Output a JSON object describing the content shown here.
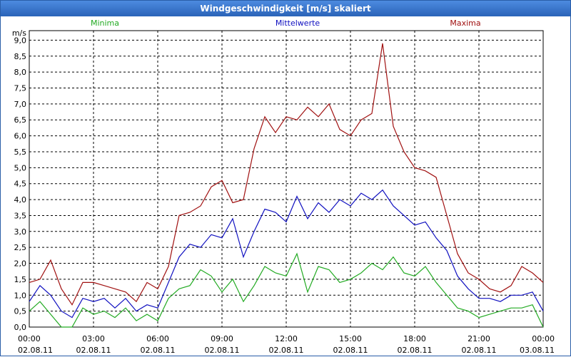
{
  "window": {
    "title": "Windgeschwindigkeit [m/s] skaliert"
  },
  "chart_data": {
    "type": "line",
    "title": "Windgeschwindigkeit [m/s] skaliert",
    "ylabel": "m/s",
    "xlabel": "",
    "ylim": [
      0,
      9.3
    ],
    "xlim": [
      0,
      24
    ],
    "grid": true,
    "legend_position": "top",
    "y_ticks": [
      "0,0",
      "0,5",
      "1,0",
      "1,5",
      "2,0",
      "2,5",
      "3,0",
      "3,5",
      "4,0",
      "4,5",
      "5,0",
      "5,5",
      "6,0",
      "6,5",
      "7,0",
      "7,5",
      "8,0",
      "8,5",
      "9,0"
    ],
    "x_ticks": [
      {
        "time": "00:00",
        "date": "02.08.11"
      },
      {
        "time": "03:00",
        "date": "02.08.11"
      },
      {
        "time": "06:00",
        "date": "02.08.11"
      },
      {
        "time": "09:00",
        "date": "02.08.11"
      },
      {
        "time": "12:00",
        "date": "02.08.11"
      },
      {
        "time": "15:00",
        "date": "02.08.11"
      },
      {
        "time": "18:00",
        "date": "02.08.11"
      },
      {
        "time": "21:00",
        "date": "02.08.11"
      },
      {
        "time": "00:00",
        "date": "03.08.11"
      }
    ],
    "x": [
      0,
      0.5,
      1,
      1.5,
      2,
      2.5,
      3,
      3.5,
      4,
      4.5,
      5,
      5.5,
      6,
      6.5,
      7,
      7.5,
      8,
      8.5,
      9,
      9.5,
      10,
      10.5,
      11,
      11.5,
      12,
      12.5,
      13,
      13.5,
      14,
      14.5,
      15,
      15.5,
      16,
      16.5,
      17,
      17.5,
      18,
      18.5,
      19,
      19.5,
      20,
      20.5,
      21,
      21.5,
      22,
      22.5,
      23,
      23.5,
      24
    ],
    "series": [
      {
        "name": "Minima",
        "color": "#22aa22",
        "values": [
          0.5,
          0.8,
          0.4,
          0.0,
          0.0,
          0.6,
          0.4,
          0.5,
          0.3,
          0.6,
          0.2,
          0.4,
          0.2,
          0.9,
          1.2,
          1.3,
          1.8,
          1.6,
          1.1,
          1.5,
          0.8,
          1.3,
          1.9,
          1.7,
          1.6,
          2.3,
          1.1,
          1.9,
          1.8,
          1.4,
          1.5,
          1.7,
          2.0,
          1.8,
          2.2,
          1.7,
          1.6,
          1.9,
          1.4,
          1.0,
          0.6,
          0.5,
          0.3,
          0.4,
          0.5,
          0.6,
          0.6,
          0.7,
          0.0
        ]
      },
      {
        "name": "Mittelwerte",
        "color": "#1010c0",
        "values": [
          0.8,
          1.3,
          1.0,
          0.5,
          0.3,
          0.9,
          0.8,
          0.9,
          0.6,
          0.9,
          0.5,
          0.7,
          0.6,
          1.4,
          2.2,
          2.6,
          2.5,
          2.9,
          2.8,
          3.4,
          2.2,
          3.0,
          3.7,
          3.6,
          3.3,
          4.1,
          3.4,
          3.9,
          3.6,
          4.0,
          3.8,
          4.2,
          4.0,
          4.3,
          3.8,
          3.5,
          3.2,
          3.3,
          2.8,
          2.4,
          1.6,
          1.2,
          0.9,
          0.9,
          0.8,
          1.0,
          1.0,
          1.1,
          0.5
        ]
      },
      {
        "name": "Maxima",
        "color": "#a01010",
        "values": [
          1.4,
          1.5,
          2.1,
          1.2,
          0.7,
          1.4,
          1.4,
          1.3,
          1.2,
          1.1,
          0.8,
          1.4,
          1.2,
          1.9,
          3.5,
          3.6,
          3.8,
          4.4,
          4.6,
          3.9,
          4.0,
          5.6,
          6.6,
          6.1,
          6.6,
          6.5,
          6.9,
          6.6,
          7.0,
          6.2,
          6.0,
          6.5,
          6.7,
          8.9,
          6.3,
          5.5,
          5.0,
          4.9,
          4.7,
          3.5,
          2.3,
          1.7,
          1.5,
          1.2,
          1.1,
          1.3,
          1.9,
          1.7,
          1.4
        ]
      }
    ]
  }
}
